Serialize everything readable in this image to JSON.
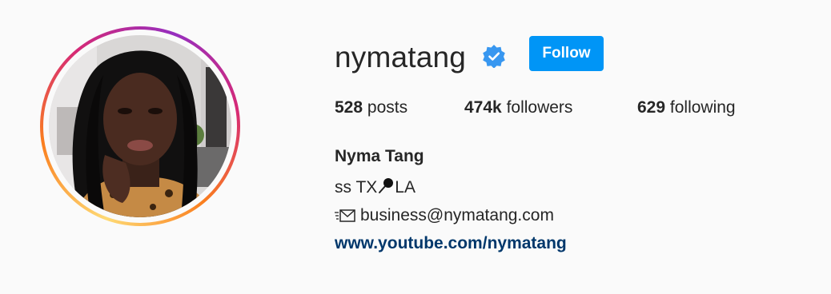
{
  "profile": {
    "username": "nymatang",
    "verified_icon": "verified-badge-icon",
    "follow_label": "Follow",
    "accent_color": "#0095f6",
    "avatar_alt": "nymatang's profile picture"
  },
  "stats": {
    "posts_count": "528",
    "posts_label": "posts",
    "followers_count": "474k",
    "followers_label": "followers",
    "following_count": "629",
    "following_label": "following"
  },
  "bio": {
    "full_name": "Nyma Tang",
    "location_prefix": "ss TX",
    "location_icon": "pushpin-icon",
    "location_suffix": "LA",
    "email_icon": "envelope-icon",
    "email": "business@nymatang.com",
    "website": "www.youtube.com/nymatang",
    "link_color": "#00376b"
  }
}
